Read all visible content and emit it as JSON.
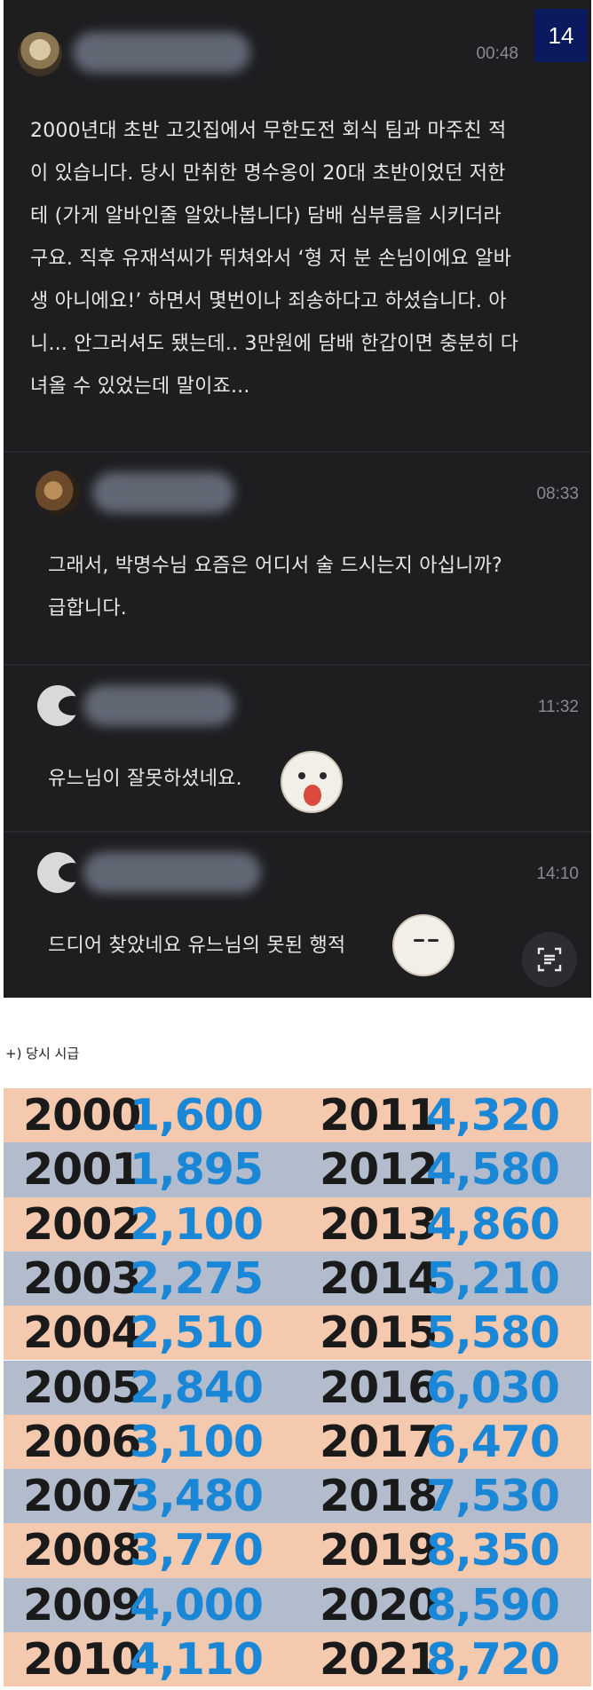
{
  "comments": [
    {
      "time": "00:48",
      "badge": "14",
      "lines": [
        "2000년대 초반 고깃집에서 무한도전 회식 팀과 마주친 적",
        "이 있습니다. 당시 만취한 명수옹이 20대 초반이었던 저한",
        "테 (가게 알바인줄 알았나봅니다) 담배 심부름을 시키더라",
        "구요. 직후 유재석씨가 뛰쳐와서 ‘형 저 분 손님이에요 알바",
        "생 아니에요!’ 하면서 몇번이나 죄송하다고 하셨습니다. 아",
        "니... 안그러셔도 됐는데.. 3만원에 담배 한갑이면 충분히 다",
        "녀올 수 있었는데 말이죠..."
      ]
    },
    {
      "time": "08:33",
      "lines": [
        "그래서, 박명수님 요즘은 어디서 술 드시는지 아십니까?",
        "급합니다."
      ]
    },
    {
      "time": "11:32",
      "lines": [
        "유느님이 잘못하셨네요."
      ]
    },
    {
      "time": "14:10",
      "lines": [
        "드디어 찾았네요 유느님의 못된 행적"
      ]
    }
  ],
  "caption": "+) 당시 시급",
  "wage_table": {
    "row_colors": [
      "#f4c9ae",
      "#b2bccc"
    ],
    "rows": [
      {
        "y1": "2000",
        "w1": "1,600",
        "y2": "2011",
        "w2": "4,320"
      },
      {
        "y1": "2001",
        "w1": "1,895",
        "y2": "2012",
        "w2": "4,580"
      },
      {
        "y1": "2002",
        "w1": "2,100",
        "y2": "2013",
        "w2": "4,860"
      },
      {
        "y1": "2003",
        "w1": "2,275",
        "y2": "2014",
        "w2": "5,210"
      },
      {
        "y1": "2004",
        "w1": "2,510",
        "y2": "2015",
        "w2": "5,580"
      },
      {
        "y1": "2005",
        "w1": "2,840",
        "y2": "2016",
        "w2": "6,030"
      },
      {
        "y1": "2006",
        "w1": "3,100",
        "y2": "2017",
        "w2": "6,470"
      },
      {
        "y1": "2007",
        "w1": "3,480",
        "y2": "2018",
        "w2": "7,530"
      },
      {
        "y1": "2008",
        "w1": "3,770",
        "y2": "2019",
        "w2": "8,350"
      },
      {
        "y1": "2009",
        "w1": "4,000",
        "y2": "2020",
        "w2": "8,590"
      },
      {
        "y1": "2010",
        "w1": "4,110",
        "y2": "2021",
        "w2": "8,720"
      }
    ]
  }
}
